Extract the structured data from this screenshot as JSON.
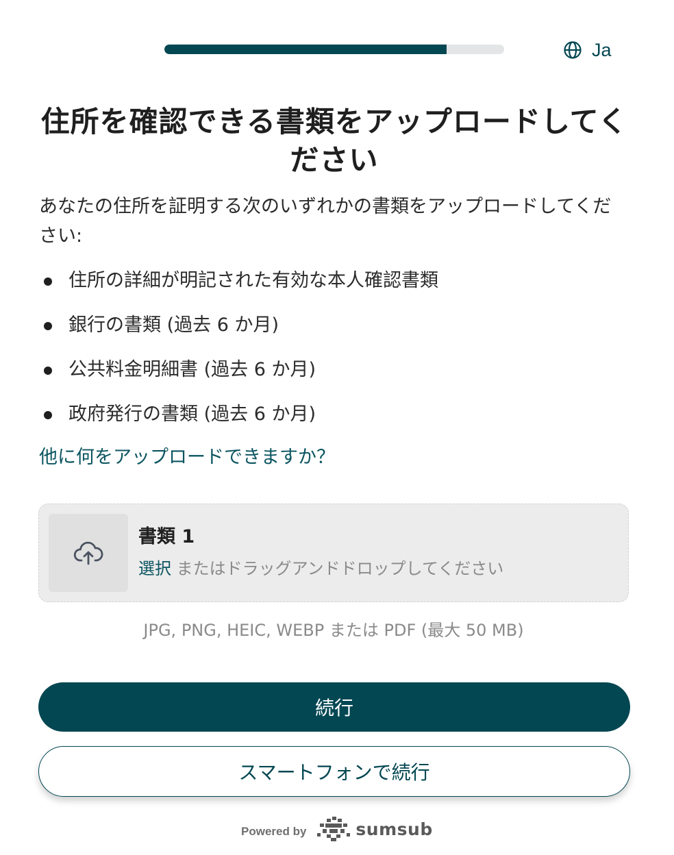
{
  "header": {
    "progress": 0.83,
    "language_label": "Ja",
    "language_icon": "globe-icon"
  },
  "title": "住所を確認できる書類をアップロードしてください",
  "intro": "あなたの住所を証明する次のいずれかの書類をアップロードしてください:",
  "document_types": [
    "住所の詳細が明記された有効な本人確認書類",
    "銀行の書類 (過去 6 か月)",
    "公共料金明細書 (過去 6 か月)",
    "政府発行の書類 (過去 6 か月)"
  ],
  "help_link": "他に何をアップロードできますか？",
  "upload": {
    "icon": "cloud-upload-icon",
    "title": "書類 1",
    "select_label": "選択",
    "drag_text": " またはドラッグアンドドロップしてください",
    "formats": "JPG, PNG, HEIC, WEBP または PDF (最大 50 MB)"
  },
  "buttons": {
    "continue": "続行",
    "continue_on_phone": "スマートフォンで続行"
  },
  "footer": {
    "powered_by": "Powered by",
    "brand": "sumsub",
    "brand_icon": "sumsub-logo-icon"
  },
  "colors": {
    "accent": "#034752",
    "link": "#0b5560",
    "track": "#e3e5e6",
    "upload_bg": "#ececec"
  }
}
